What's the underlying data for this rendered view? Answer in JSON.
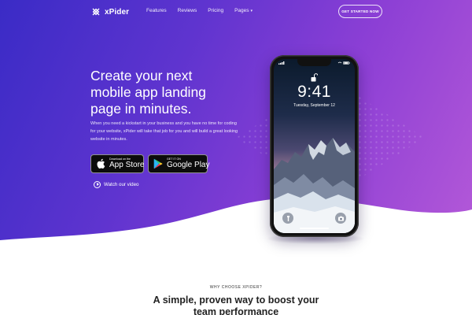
{
  "brand": {
    "name": "xPider"
  },
  "nav": {
    "links": [
      "Features",
      "Reviews",
      "Pricing"
    ],
    "pages_label": "Pages",
    "cta_label": "GET STARTED NOW"
  },
  "hero": {
    "headline_lines": [
      "Create your next",
      "mobile app landing",
      "page in minutes."
    ],
    "lead": "When you need a kickstart in your business and you have no time for coding for your website, xPider will take that job for you and will build a great looking website in minutes.",
    "app_store": {
      "small": "Download on the",
      "big": "App Store"
    },
    "google_play": {
      "small": "GET IT ON",
      "big": "Google Play"
    },
    "watch_label": "Watch our video"
  },
  "phone": {
    "time": "9:41",
    "date": "Tuesday, September 12"
  },
  "section": {
    "eyebrow": "WHY CHOOSE XPIDER?",
    "title_lines": [
      "A simple, proven way to boost your",
      "team performance"
    ]
  },
  "colors": {
    "gradient_start": "#3a2bc6",
    "gradient_mid": "#8c3fd5",
    "gradient_end": "#b65ad8",
    "button_black": "#0c0c0c"
  },
  "icons": {
    "logo": "xpider-logo-icon",
    "apple": "apple-icon",
    "google_play": "google-play-icon",
    "play": "play-circle-icon",
    "lock": "unlock-icon",
    "flash": "flashlight-icon",
    "camera": "camera-icon"
  }
}
